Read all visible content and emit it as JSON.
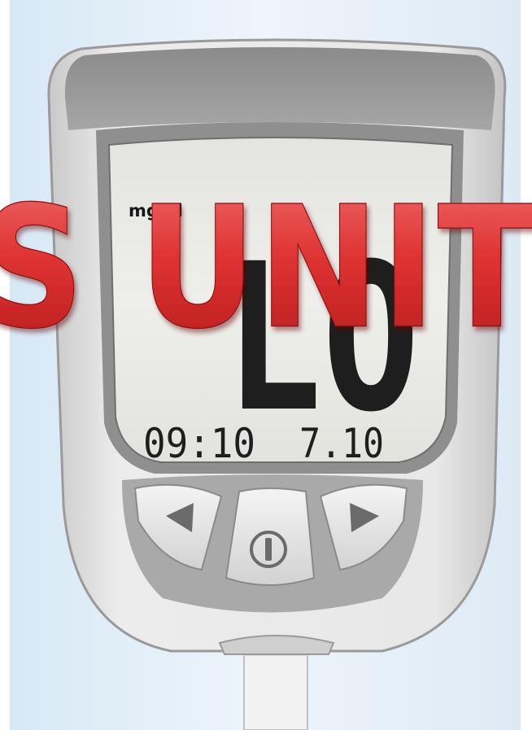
{
  "meter": {
    "unit": "mg/dl",
    "reading": "LO",
    "time": "09:10",
    "date": "7.10"
  },
  "buttons": {
    "left": {
      "icon": "left-arrow-icon"
    },
    "center": {
      "icon": "power-icon"
    },
    "right": {
      "icon": "right-arrow-icon"
    }
  },
  "overlay": {
    "text": "S UNIT",
    "color": "#d42a2a"
  }
}
